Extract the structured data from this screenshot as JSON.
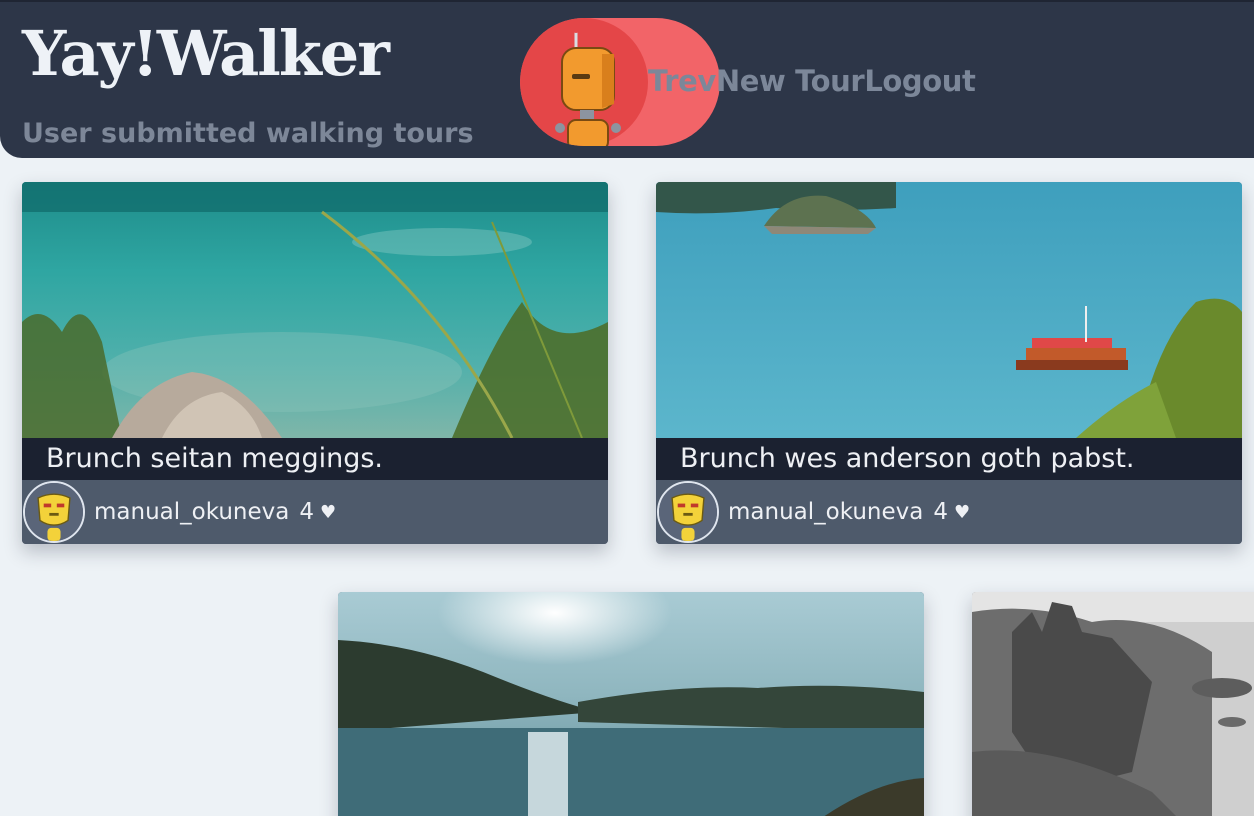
{
  "app": {
    "title": "Yay!Walker",
    "subtitle": "User submitted walking tours"
  },
  "nav": {
    "user_name": "Trev",
    "new_tour": "New Tour",
    "logout": "Logout"
  },
  "colors": {
    "header_bg": "#2d3648",
    "page_bg": "#edf2f6",
    "accent_pill": "#f26468",
    "caption_bg": "#1b2130",
    "meta_bg": "#4e5a6b"
  },
  "tours": [
    {
      "caption": "Brunch seitan meggings.",
      "author": "manual_okuneva",
      "likes": "4",
      "heart_icon": "heart-icon",
      "photo": "turquoise lake with rocks and grasses"
    },
    {
      "caption": "Brunch wes anderson goth pabst.",
      "author": "manual_okuneva",
      "likes": "4",
      "heart_icon": "heart-icon",
      "photo": "bay with islands and red boat"
    },
    {
      "photo": "sunset over lake and hills"
    },
    {
      "photo": "black and white sea cliff ruins"
    }
  ]
}
